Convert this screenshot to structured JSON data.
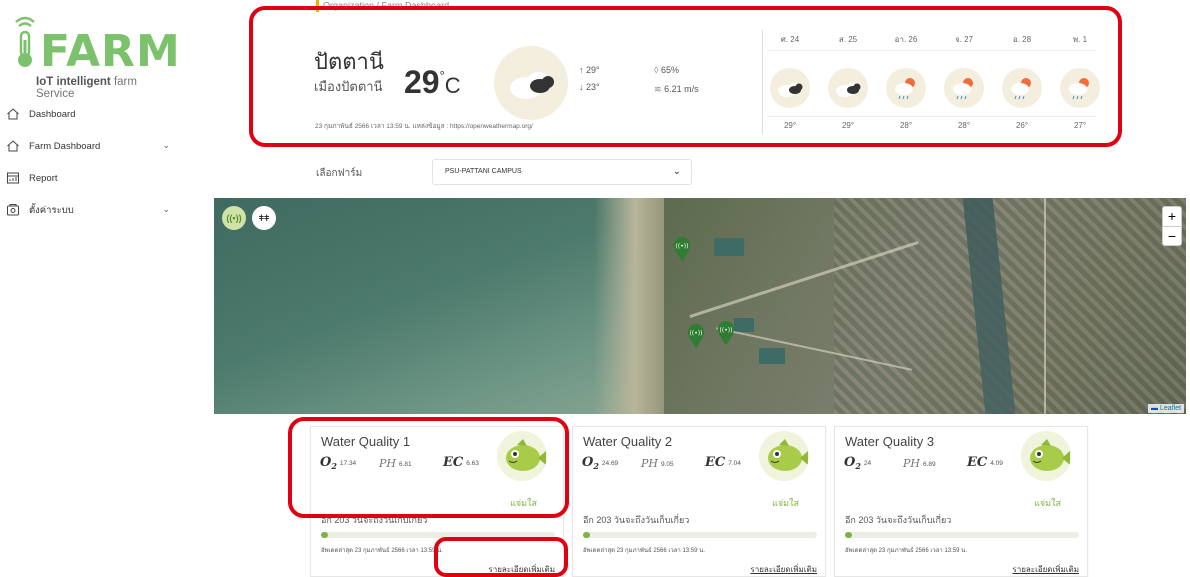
{
  "app": {
    "logo_word": "FARM",
    "logo_sub_bold": "IoT intelligent",
    "logo_sub_light": "farm Service"
  },
  "sidebar": {
    "items": [
      {
        "label": "Dashboard",
        "icon": "home-icon"
      },
      {
        "label": "Farm Dashboard",
        "icon": "home-icon",
        "has_submenu": true
      },
      {
        "label": "Report",
        "icon": "report-icon"
      },
      {
        "label": "ตั้งค่าระบบ",
        "icon": "settings-box-icon",
        "has_submenu": true
      }
    ]
  },
  "breadcrumb": {
    "link": "Organization",
    "current": "Farm Dashboard"
  },
  "weather": {
    "province": "ปัตตานี",
    "district": "เมืองปัตตานี",
    "temp": "29",
    "unit": "C",
    "high": "29",
    "low": "23",
    "humidity": "65%",
    "wind": "6.21 m/s",
    "source": "23 กุมภาพันธ์ 2566 เวลา 13:59 น. แหล่งข้อมูล : https://openweathermap.org/",
    "forecast": [
      {
        "day": "ศ. 24",
        "temp": "29",
        "condition": "cloudy"
      },
      {
        "day": "ส. 25",
        "temp": "29",
        "condition": "cloudy"
      },
      {
        "day": "อา. 26",
        "temp": "28",
        "condition": "rain"
      },
      {
        "day": "จ. 27",
        "temp": "28",
        "condition": "rain"
      },
      {
        "day": "อ. 28",
        "temp": "26",
        "condition": "rain"
      },
      {
        "day": "พ. 1",
        "temp": "27",
        "condition": "rain"
      }
    ]
  },
  "farm_selector": {
    "label": "เลือกฟาร์ม",
    "selected": "PSU-PATTANI CAMPUS"
  },
  "map": {
    "attribution": "Leaflet",
    "zoom_in": "+",
    "zoom_out": "−"
  },
  "cards": [
    {
      "title": "Water Quality 1",
      "o2": "17.34",
      "ph": "6.81",
      "ec": "6.63",
      "status": "แจ่มใส",
      "days_left": "อีก 203 วันจะถึงวันเก็บเกี่ยว",
      "progress": 0.03,
      "updated": "อัพเดตล่าสุด 23 กุมภาพันธ์ 2566 เวลา 13:59 น.",
      "link": "รายละเอียดเพิ่มเติม"
    },
    {
      "title": "Water Quality 2",
      "o2": "24.69",
      "ph": "9.05",
      "ec": "7.04",
      "status": "แจ่มใส",
      "days_left": "อีก 203 วันจะถึงวันเก็บเกี่ยว",
      "progress": 0.03,
      "updated": "อัพเดตล่าสุด 23 กุมภาพันธ์ 2566 เวลา 13:59 น.",
      "link": "รายละเอียดเพิ่มเติม"
    },
    {
      "title": "Water Quality 3",
      "o2": "24",
      "ph": "6.89",
      "ec": "4.09",
      "status": "แจ่มใส",
      "days_left": "อีก 203 วันจะถึงวันเก็บเกี่ยว",
      "progress": 0.03,
      "updated": "อัพเดตล่าสุด 23 กุมภาพันธ์ 2566 เวลา 13:59 น.",
      "link": "รายละเอียดเพิ่มเติม"
    }
  ],
  "metric_labels": {
    "o2": "O",
    "o2_sub": "2",
    "ph": "PH",
    "ec": "EC"
  },
  "colors": {
    "brand_green": "#7cc26c",
    "annotation_red": "#e00012",
    "status_green": "#7cb342"
  }
}
